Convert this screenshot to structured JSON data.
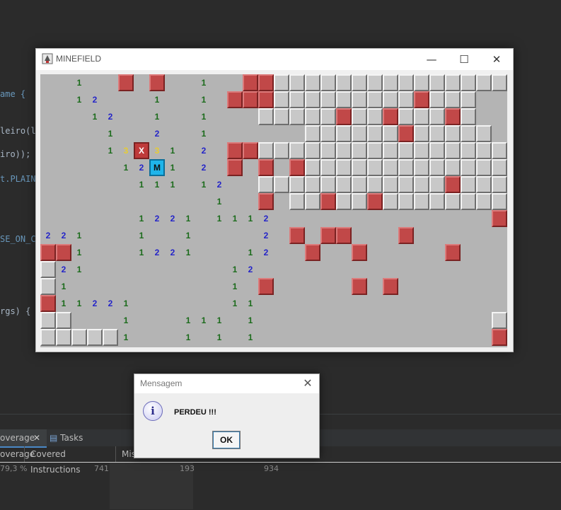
{
  "code_snippets": [
    "ame {",
    "leiro(l",
    "iro));",
    "t.PLAIN",
    "SE_ON_C",
    "rgs) {"
  ],
  "code_colors": [
    "#6897bb",
    "#a9b7c6",
    "#a9b7c6",
    "#6897bb",
    "#6897bb",
    "#a9b7c6"
  ],
  "ide": {
    "tabs": [
      "overage",
      "Tasks"
    ],
    "columns": [
      "overage",
      "Covered Instructions",
      "Mis"
    ],
    "values": [
      "79,3 %",
      "741",
      "193",
      "934"
    ]
  },
  "window": {
    "title": "MINEFIELD",
    "minimize_glyph": "—",
    "maximize_glyph": "☐",
    "close_glyph": "✕"
  },
  "board": {
    "rows": 16,
    "cols": 30,
    "legend": "o=open, #=closed, F=flag, X=exploded mine, M=mine, digits=counts",
    "grid": [
      "oooooFoFoooooFF###############",
      "ooooooooooooFFF#########F###oo",
      "oooooooooooooo#####F##F###F#oo",
      "ooooooooooooooooo######F#####o",
      "ooooooooooooFF################",
      "ooooooooooooFoFoF#############",
      "oooooooooooooo############F###",
      "ooooooooooooooFo##F##F########",
      "oooooooooooooooooooooooooooooF",
      "ooooooooooooooooFoFFoooFoooooo",
      "FFoooooooooooooooFooFoooooFooo",
      "#ooooooooooooooooooooooooooooo",
      "#oooooooooooooFoooooFoFooooooo",
      "Fooooooooooooooooooooooooooooo",
      "##ooooooooooooooooooooooooooo#",
      "#####ooooooooooooooooooooooooF"
    ]
  },
  "board_rows_text": [
    [
      "",
      "",
      "",
      "",
      "",
      "",
      "",
      "",
      "",
      "",
      "",
      "",
      "",
      "",
      "",
      "",
      "",
      "",
      "",
      "",
      "",
      "",
      "",
      "",
      "",
      "",
      "",
      "",
      "",
      ""
    ]
  ],
  "numbers": [
    {
      "r": 0,
      "c": 2,
      "v": "1"
    },
    {
      "r": 0,
      "c": 7,
      "v": "1"
    },
    {
      "r": 0,
      "c": 10,
      "v": "1"
    },
    {
      "r": 1,
      "c": 2,
      "v": "1"
    },
    {
      "r": 1,
      "c": 3,
      "v": "2"
    },
    {
      "r": 1,
      "c": 7,
      "v": "1"
    },
    {
      "r": 1,
      "c": 10,
      "v": "1"
    },
    {
      "r": 2,
      "c": 3,
      "v": "1"
    },
    {
      "r": 2,
      "c": 4,
      "v": "2"
    },
    {
      "r": 2,
      "c": 7,
      "v": "1"
    },
    {
      "r": 2,
      "c": 10,
      "v": "1"
    },
    {
      "r": 3,
      "c": 4,
      "v": "1"
    },
    {
      "r": 3,
      "c": 7,
      "v": "2"
    },
    {
      "r": 3,
      "c": 10,
      "v": "1"
    },
    {
      "r": 4,
      "c": 4,
      "v": "1"
    },
    {
      "r": 4,
      "c": 5,
      "v": "3"
    },
    {
      "r": 4,
      "c": 7,
      "v": "3"
    },
    {
      "r": 4,
      "c": 8,
      "v": "1"
    },
    {
      "r": 4,
      "c": 10,
      "v": "2"
    },
    {
      "r": 5,
      "c": 5,
      "v": "1"
    },
    {
      "r": 5,
      "c": 6,
      "v": "2"
    },
    {
      "r": 5,
      "c": 8,
      "v": "1"
    },
    {
      "r": 5,
      "c": 10,
      "v": "2"
    },
    {
      "r": 6,
      "c": 6,
      "v": "1"
    },
    {
      "r": 6,
      "c": 7,
      "v": "1"
    },
    {
      "r": 6,
      "c": 8,
      "v": "1"
    },
    {
      "r": 6,
      "c": 10,
      "v": "1"
    },
    {
      "r": 6,
      "c": 11,
      "v": "2"
    },
    {
      "r": 7,
      "c": 11,
      "v": "1"
    },
    {
      "r": 8,
      "c": 6,
      "v": "1"
    },
    {
      "r": 8,
      "c": 7,
      "v": "2"
    },
    {
      "r": 8,
      "c": 8,
      "v": "2"
    },
    {
      "r": 8,
      "c": 9,
      "v": "1"
    },
    {
      "r": 8,
      "c": 11,
      "v": "1"
    },
    {
      "r": 8,
      "c": 12,
      "v": "1"
    },
    {
      "r": 8,
      "c": 13,
      "v": "1"
    },
    {
      "r": 8,
      "c": 14,
      "v": "2"
    },
    {
      "r": 9,
      "c": 0,
      "v": "2"
    },
    {
      "r": 9,
      "c": 1,
      "v": "2"
    },
    {
      "r": 9,
      "c": 2,
      "v": "1"
    },
    {
      "r": 9,
      "c": 6,
      "v": "1"
    },
    {
      "r": 9,
      "c": 9,
      "v": "1"
    },
    {
      "r": 9,
      "c": 14,
      "v": "2"
    },
    {
      "r": 10,
      "c": 2,
      "v": "1"
    },
    {
      "r": 10,
      "c": 6,
      "v": "1"
    },
    {
      "r": 10,
      "c": 7,
      "v": "2"
    },
    {
      "r": 10,
      "c": 8,
      "v": "2"
    },
    {
      "r": 10,
      "c": 9,
      "v": "1"
    },
    {
      "r": 10,
      "c": 13,
      "v": "1"
    },
    {
      "r": 10,
      "c": 14,
      "v": "2"
    },
    {
      "r": 11,
      "c": 1,
      "v": "2"
    },
    {
      "r": 11,
      "c": 2,
      "v": "1"
    },
    {
      "r": 11,
      "c": 12,
      "v": "1"
    },
    {
      "r": 11,
      "c": 13,
      "v": "2"
    },
    {
      "r": 12,
      "c": 1,
      "v": "1"
    },
    {
      "r": 12,
      "c": 12,
      "v": "1"
    },
    {
      "r": 13,
      "c": 1,
      "v": "1"
    },
    {
      "r": 13,
      "c": 2,
      "v": "1"
    },
    {
      "r": 13,
      "c": 3,
      "v": "2"
    },
    {
      "r": 13,
      "c": 4,
      "v": "2"
    },
    {
      "r": 13,
      "c": 5,
      "v": "1"
    },
    {
      "r": 13,
      "c": 12,
      "v": "1"
    },
    {
      "r": 13,
      "c": 13,
      "v": "1"
    },
    {
      "r": 14,
      "c": 5,
      "v": "1"
    },
    {
      "r": 14,
      "c": 9,
      "v": "1"
    },
    {
      "r": 14,
      "c": 10,
      "v": "1"
    },
    {
      "r": 14,
      "c": 11,
      "v": "1"
    },
    {
      "r": 14,
      "c": 13,
      "v": "1"
    },
    {
      "r": 15,
      "c": 5,
      "v": "1"
    },
    {
      "r": 15,
      "c": 9,
      "v": "1"
    },
    {
      "r": 15,
      "c": 11,
      "v": "1"
    },
    {
      "r": 15,
      "c": 13,
      "v": "1"
    }
  ],
  "exploded_cell": {
    "r": 4,
    "c": 6,
    "v": "X"
  },
  "mine_cell": {
    "r": 5,
    "c": 7,
    "v": "M"
  },
  "dialog": {
    "title": "Mensagem",
    "close_glyph": "✕",
    "icon_glyph": "i",
    "message": "PERDEU !!!",
    "ok_label": "OK"
  }
}
